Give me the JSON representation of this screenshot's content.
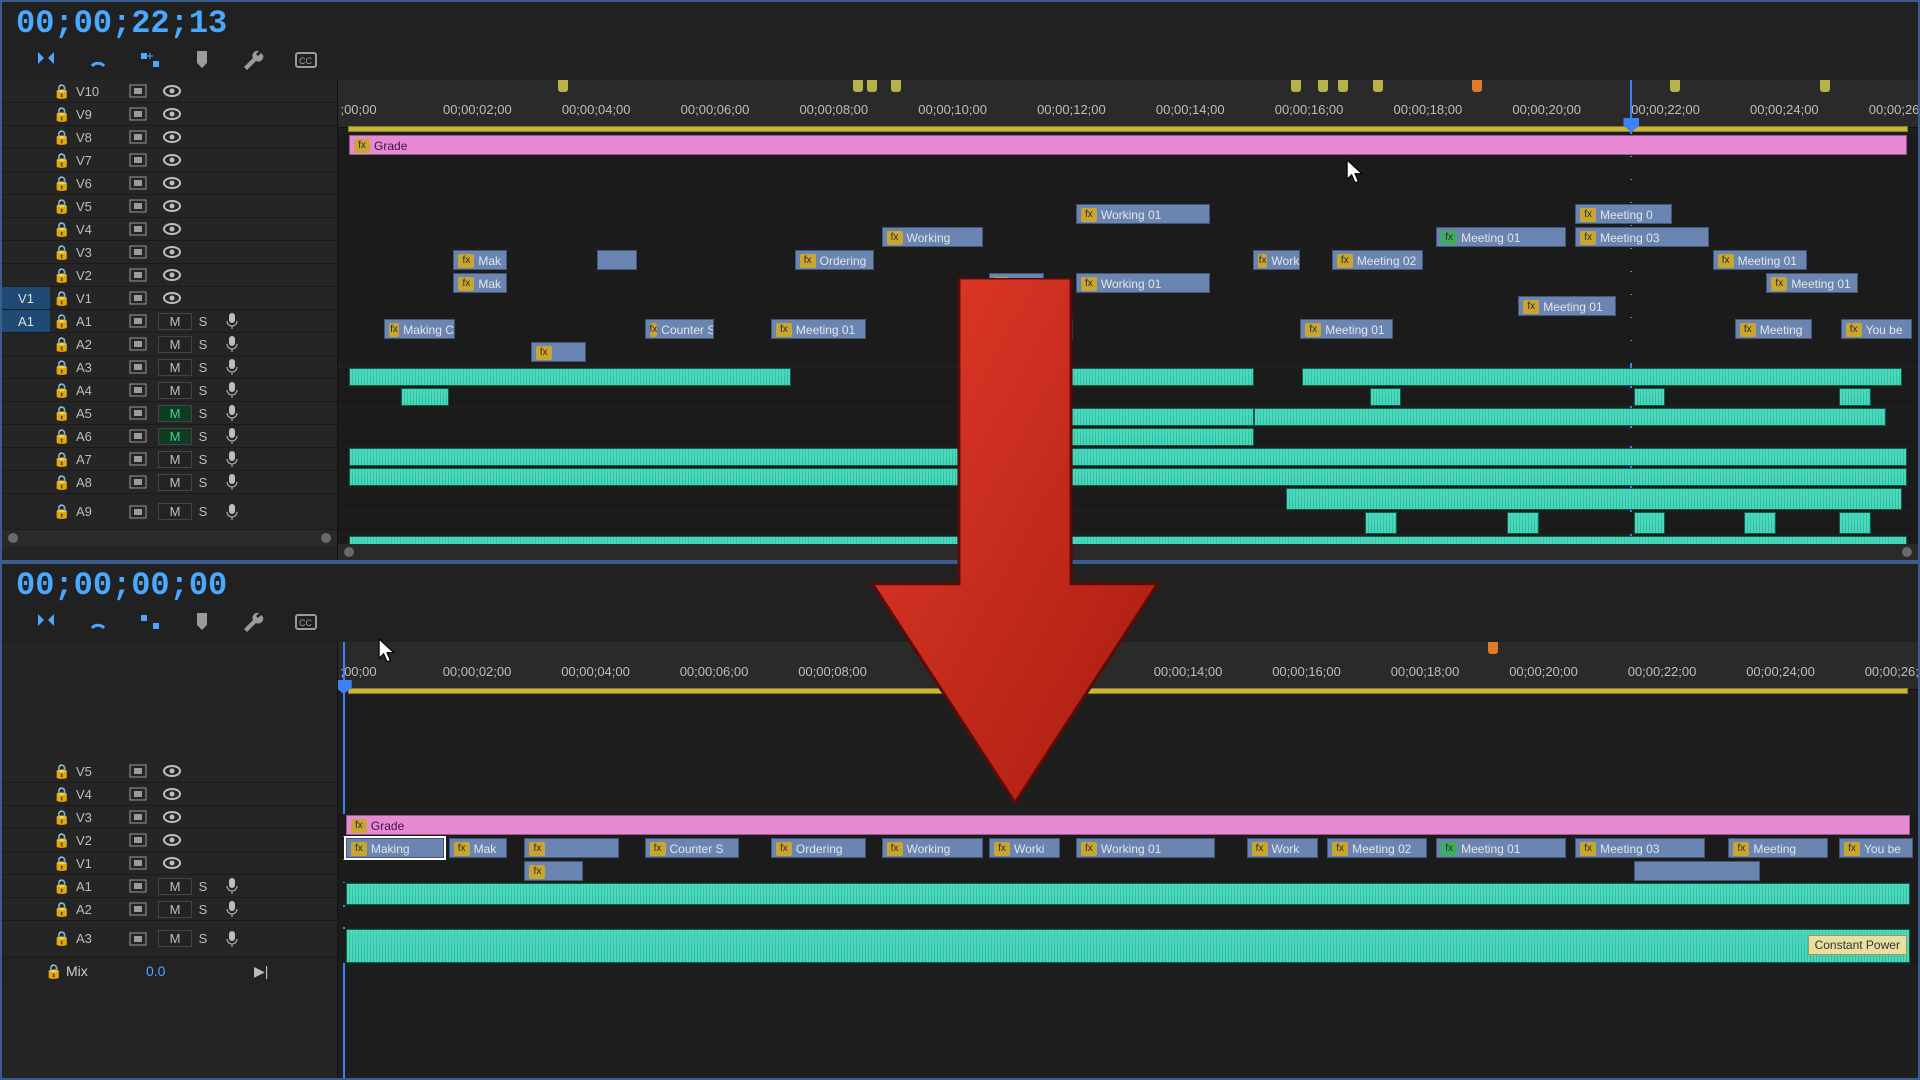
{
  "top": {
    "timecode": "00;00;22;13",
    "ruler": {
      "ticks": [
        ";00;00",
        "00;00;02;00",
        "00;00;04;00",
        "00;00;06;00",
        "00;00;08;00",
        "00;00;10;00",
        "00;00;12;00",
        "00;00;14;00",
        "00;00;16;00",
        "00;00;18;00",
        "00;00;20;00",
        "00;00;22;00",
        "00;00;24;00",
        "00;00;26;00"
      ],
      "markers": [
        {
          "pct": 13.9,
          "c": "y"
        },
        {
          "pct": 32.6,
          "c": "y"
        },
        {
          "pct": 33.5,
          "c": "y"
        },
        {
          "pct": 35.0,
          "c": "y"
        },
        {
          "pct": 60.3,
          "c": "y"
        },
        {
          "pct": 62.0,
          "c": "y"
        },
        {
          "pct": 63.3,
          "c": "y"
        },
        {
          "pct": 65.5,
          "c": "y"
        },
        {
          "pct": 71.8,
          "c": "o"
        },
        {
          "pct": 84.3,
          "c": "y"
        },
        {
          "pct": 93.8,
          "c": "y"
        }
      ],
      "playhead_pct": 81.8
    },
    "videoTracks": [
      "V10",
      "V9",
      "V8",
      "V7",
      "V6",
      "V5",
      "V4",
      "V3",
      "V2",
      "V1"
    ],
    "sourceV": "V1",
    "audioTracks": [
      "A1",
      "A2",
      "A3",
      "A4",
      "A5",
      "A6",
      "A7",
      "A8",
      "A9"
    ],
    "sourceA": "A1",
    "mutedGreen": [
      "A5",
      "A6"
    ],
    "grade_label": "Grade",
    "clips": {
      "V7": [
        {
          "l": 46.7,
          "w": 8.5,
          "t": "Working 01",
          "fx": "y"
        },
        {
          "l": 78.3,
          "w": 6.1,
          "t": "Meeting 0",
          "fx": "y"
        }
      ],
      "V6": [
        {
          "l": 34.4,
          "w": 6.4,
          "t": "Working",
          "fx": "y"
        },
        {
          "l": 69.5,
          "w": 8.2,
          "t": "Meeting 01",
          "fx": "g"
        },
        {
          "l": 78.3,
          "w": 8.5,
          "t": "Meeting 03",
          "fx": "y"
        }
      ],
      "V5": [
        {
          "l": 7.3,
          "w": 3.4,
          "t": "Mak",
          "fx": "y"
        },
        {
          "l": 16.4,
          "w": 2.5,
          "t": "",
          "fx": ""
        },
        {
          "l": 28.9,
          "w": 5.0,
          "t": "Ordering",
          "fx": "y"
        },
        {
          "l": 57.9,
          "w": 3.0,
          "t": "Work",
          "fx": "y"
        },
        {
          "l": 62.9,
          "w": 5.8,
          "t": "Meeting 02",
          "fx": "y"
        },
        {
          "l": 87.0,
          "w": 6.0,
          "t": "Meeting 01",
          "fx": "y"
        }
      ],
      "V4": [
        {
          "l": 7.3,
          "w": 3.4,
          "t": "Mak",
          "fx": "y"
        },
        {
          "l": 41.2,
          "w": 3.5,
          "t": "Worki",
          "fx": "y"
        },
        {
          "l": 46.7,
          "w": 8.5,
          "t": "Working 01",
          "fx": "y"
        },
        {
          "l": 90.4,
          "w": 5.8,
          "t": "Meeting 01",
          "fx": "y"
        }
      ],
      "V3": [
        {
          "l": 41.2,
          "w": 3.5,
          "t": "Worki",
          "fx": "y"
        },
        {
          "l": 74.7,
          "w": 6.2,
          "t": "Meeting 01",
          "fx": "y"
        }
      ],
      "V2": [
        {
          "l": 2.9,
          "w": 4.5,
          "t": "Making C",
          "fx": "y"
        },
        {
          "l": 19.4,
          "w": 4.4,
          "t": "Counter S",
          "fx": "y"
        },
        {
          "l": 27.4,
          "w": 6.0,
          "t": "Meeting 01",
          "fx": "y"
        },
        {
          "l": 42.4,
          "w": 4.1,
          "t": "01",
          "fx": "y"
        },
        {
          "l": 60.9,
          "w": 5.9,
          "t": "Meeting 01",
          "fx": "y"
        },
        {
          "l": 88.4,
          "w": 4.9,
          "t": "Meeting",
          "fx": "y"
        },
        {
          "l": 95.1,
          "w": 4.5,
          "t": "You be",
          "fx": "y"
        }
      ],
      "V1": [
        {
          "l": 12.2,
          "w": 3.5,
          "t": "",
          "fx": "y"
        }
      ]
    },
    "constant_power": "Constant Power"
  },
  "bottom": {
    "timecode": "00;00;00;00",
    "ruler": {
      "ticks": [
        ";00;00",
        "00;00;02;00",
        "00;00;04;00",
        "00;00;06;00",
        "00;00;08;00",
        "00;00;14;00",
        "00;00;16;00",
        "00;00;18;00",
        "00;00;20;00",
        "00;00;22;00",
        "00;00;24;00",
        "00;00;26;00"
      ],
      "tickpos": [
        1.3,
        8.8,
        16.3,
        23.8,
        31.3,
        53.8,
        61.3,
        68.8,
        76.3,
        83.8,
        91.3,
        98.8
      ],
      "markers": [
        {
          "pct": 72.8,
          "c": "o"
        }
      ],
      "playhead_pct": 0.3
    },
    "videoTracks": [
      "V5",
      "V4",
      "V3",
      "V2",
      "V1"
    ],
    "audioTracks": [
      "A1",
      "A2",
      "A3"
    ],
    "grade_label": "Grade",
    "v1clips": [
      {
        "l": 0.5,
        "w": 6.2,
        "t": "Making",
        "fx": "y",
        "sel": true
      },
      {
        "l": 7.0,
        "w": 3.7,
        "t": "Mak",
        "fx": "y"
      },
      {
        "l": 11.8,
        "w": 6.0,
        "t": "",
        "fx": "y"
      },
      {
        "l": 19.4,
        "w": 6.0,
        "t": "Counter S",
        "fx": "y"
      },
      {
        "l": 27.4,
        "w": 6.0,
        "t": "Ordering",
        "fx": "y"
      },
      {
        "l": 34.4,
        "w": 6.4,
        "t": "Working",
        "fx": "y"
      },
      {
        "l": 41.2,
        "w": 4.5,
        "t": "Worki",
        "fx": "y"
      },
      {
        "l": 46.7,
        "w": 8.8,
        "t": "Working 01",
        "fx": "y"
      },
      {
        "l": 57.5,
        "w": 4.5,
        "t": "Work",
        "fx": "y"
      },
      {
        "l": 62.6,
        "w": 6.3,
        "t": "Meeting 02",
        "fx": "y"
      },
      {
        "l": 69.5,
        "w": 8.2,
        "t": "Meeting 01",
        "fx": "g"
      },
      {
        "l": 78.3,
        "w": 8.2,
        "t": "Meeting 03",
        "fx": "y"
      },
      {
        "l": 88.0,
        "w": 6.3,
        "t": "Meeting",
        "fx": "y"
      },
      {
        "l": 95.0,
        "w": 4.7,
        "t": "You be",
        "fx": "y"
      }
    ],
    "constant_power": "Constant Power",
    "mix": {
      "label": "Mix",
      "value": "0.0"
    }
  }
}
